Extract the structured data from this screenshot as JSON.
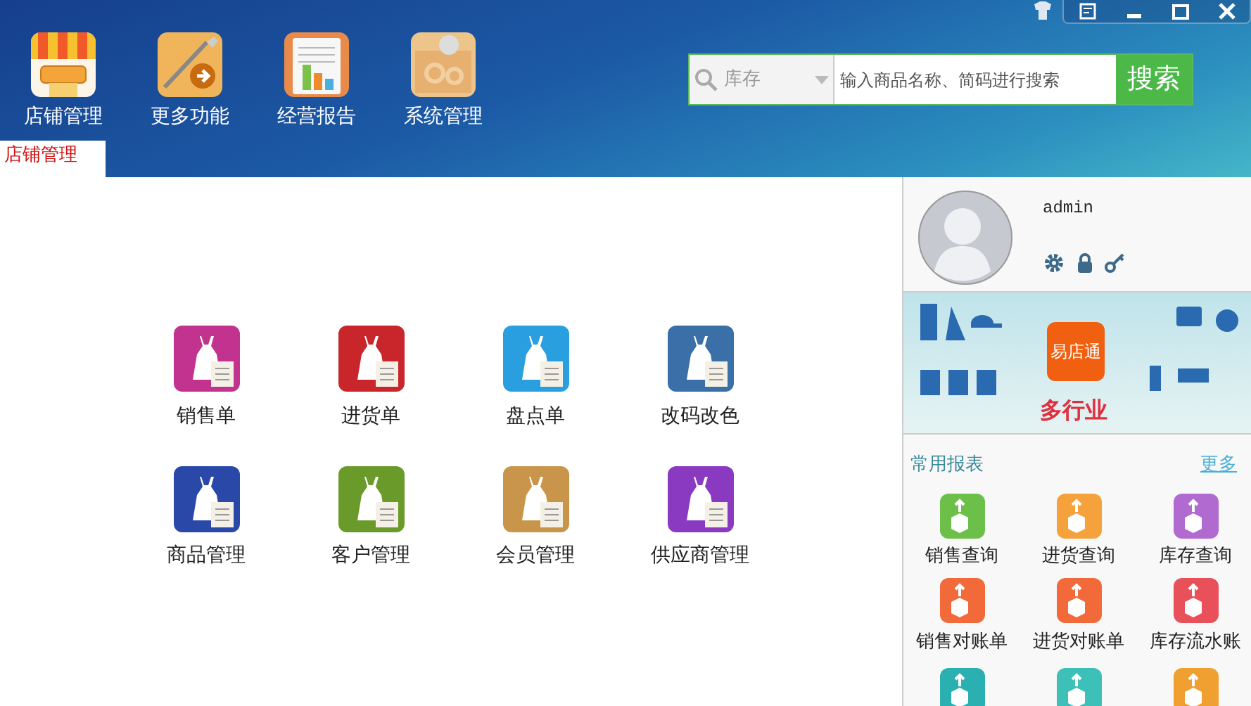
{
  "toolbar": [
    {
      "kind": "store",
      "label": "店铺管理"
    },
    {
      "kind": "tools",
      "label": "更多功能"
    },
    {
      "kind": "report",
      "label": "经营报告"
    },
    {
      "kind": "settings",
      "label": "系统管理"
    }
  ],
  "window_controls": [
    {
      "kind": "skin"
    },
    {
      "kind": "notes"
    },
    {
      "kind": "minimize"
    },
    {
      "kind": "maximize"
    },
    {
      "kind": "close"
    }
  ],
  "search": {
    "category": "库存",
    "placeholder": "输入商品名称、简码进行搜索",
    "button": "搜索"
  },
  "tabs": [
    {
      "label": "店铺管理",
      "selected": true
    }
  ],
  "tiles": [
    {
      "label": "销售单",
      "color": "#c2338f"
    },
    {
      "label": "进货单",
      "color": "#c8262a"
    },
    {
      "label": "盘点单",
      "color": "#2a9fe0"
    },
    {
      "label": "改码改色",
      "color": "#3a6fa8"
    },
    {
      "label": "商品管理",
      "color": "#2a48a8"
    },
    {
      "label": "客户管理",
      "color": "#6a9a2a"
    },
    {
      "label": "会员管理",
      "color": "#c8954a"
    },
    {
      "label": "供应商管理",
      "color": "#8a3ac0"
    }
  ],
  "user": {
    "name": "admin"
  },
  "banner": {
    "brand": "易店通",
    "slogan": "多行业"
  },
  "reports": {
    "title": "常用报表",
    "more": "更多",
    "items": [
      {
        "label": "销售查询",
        "color": "#6cc04a"
      },
      {
        "label": "进货查询",
        "color": "#f5a23c"
      },
      {
        "label": "库存查询",
        "color": "#b06ad0"
      },
      {
        "label": "销售对账单",
        "color": "#f2693a"
      },
      {
        "label": "进货对账单",
        "color": "#f2693a"
      },
      {
        "label": "库存流水账",
        "color": "#e8505a"
      },
      {
        "color": "#2ab0b0"
      },
      {
        "color": "#3cc0b8"
      },
      {
        "color": "#f0a030"
      }
    ]
  }
}
